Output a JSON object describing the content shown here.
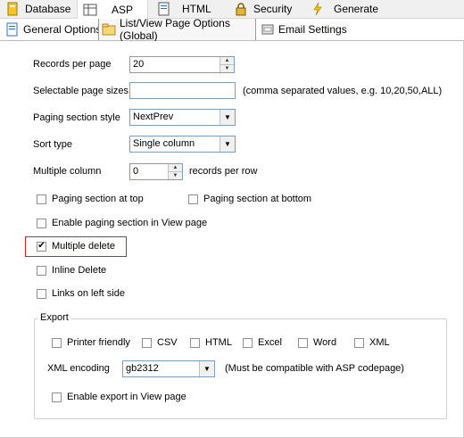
{
  "top_tabs": [
    {
      "label": "Database",
      "icon": "database-icon"
    },
    {
      "label": "ASP",
      "icon": "grid-icon"
    },
    {
      "label": "HTML",
      "icon": "html-page-icon"
    },
    {
      "label": "Security",
      "icon": "lock-icon"
    },
    {
      "label": "Generate",
      "icon": "lightning-icon"
    }
  ],
  "sub_tabs": [
    {
      "label": "General Options",
      "icon": "page-icon"
    },
    {
      "label": "List/View Page Options (Global)",
      "icon": "folder-icon"
    },
    {
      "label": "Email Settings",
      "icon": "email-icon"
    }
  ],
  "form": {
    "records_per_page_label": "Records per page",
    "records_per_page_value": "20",
    "selectable_sizes_label": "Selectable page sizes",
    "selectable_sizes_value": "",
    "selectable_sizes_hint": "(comma separated values, e.g. 10,20,50,ALL)",
    "paging_style_label": "Paging section style",
    "paging_style_value": "NextPrev",
    "sort_type_label": "Sort type",
    "sort_type_value": "Single column",
    "multiple_column_label": "Multiple column",
    "multiple_column_value": "0",
    "multiple_column_suffix": "records per row",
    "paging_top_label": "Paging section at top",
    "paging_bottom_label": "Paging section at bottom",
    "paging_view_label": "Enable paging section in View page",
    "multiple_delete_label": "Multiple delete",
    "inline_delete_label": "Inline Delete",
    "links_left_label": "Links on left side"
  },
  "checks": {
    "paging_top": false,
    "paging_bottom": false,
    "paging_view": false,
    "multiple_delete": true,
    "inline_delete": false,
    "links_left": false
  },
  "export": {
    "title": "Export",
    "printer_friendly": "Printer friendly",
    "csv": "CSV",
    "html": "HTML",
    "excel": "Excel",
    "word": "Word",
    "xml": "XML",
    "xml_encoding_label": "XML encoding",
    "xml_encoding_value": "gb2312",
    "xml_encoding_hint": "(Must be compatible with ASP codepage)",
    "enable_view_label": "Enable export in View page"
  },
  "colors": {
    "highlight": "#e21e1e",
    "field_border": "#7f9db9"
  }
}
